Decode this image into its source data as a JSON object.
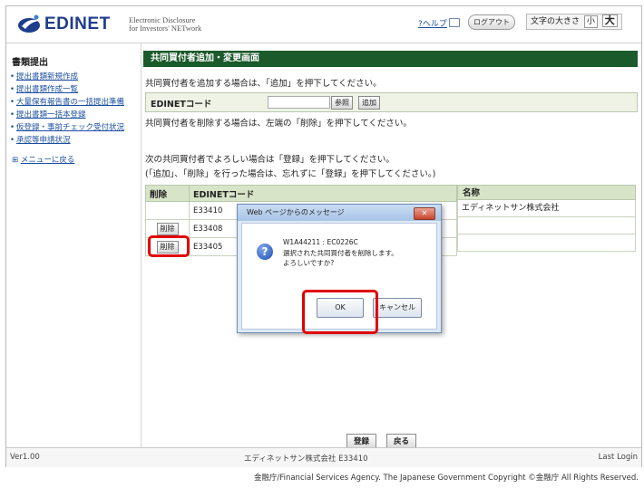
{
  "header": {
    "logo_text": "EDINET",
    "logo_subtitle_1": "Electronic Disclosure",
    "logo_subtitle_2": "for Investors' NETwork",
    "help_label": "?ヘルプ",
    "logout_label": "ログアウト",
    "font_size_label": "文字の大きさ",
    "font_small": "小",
    "font_large": "大"
  },
  "sidebar": {
    "title": "書類提出",
    "items": [
      {
        "label": "提出書類新規作成"
      },
      {
        "label": "提出書類作成一覧"
      },
      {
        "label": "大量保有報告書の一括提出準備"
      },
      {
        "label": "提出書類一括本登録"
      },
      {
        "label": "仮登録・事前チェック受付状況"
      },
      {
        "label": "承認等申請状況"
      }
    ],
    "back_label": "メニューに戻る"
  },
  "main": {
    "page_title": "共同買付者追加・変更画面",
    "add_instruction": "共同買付者を追加する場合は、「追加」を押下してください。",
    "code_label": "EDINETコード",
    "code_value": "",
    "ref_button": "参照",
    "add_button": "追加",
    "delete_instruction": "共同買付者を削除する場合は、左端の「削除」を押下してください。",
    "register_instruction_1": "次の共同買付者でよろしい場合は「登録」を押下してください。",
    "register_instruction_2": "(「追加」、「削除」を行った場合は、忘れずに「登録」を押下してください。)",
    "table": {
      "headers": {
        "delete": "削除",
        "code": "EDINETコード",
        "name": "名称"
      },
      "rows": [
        {
          "delete": "",
          "code": "E33410",
          "name": "エディネットサン株式会社"
        },
        {
          "delete": "削除",
          "code": "E33408",
          "name": ""
        },
        {
          "delete": "削除",
          "code": "E33405",
          "name": ""
        }
      ]
    },
    "register_button": "登録",
    "back_button": "戻る"
  },
  "dialog": {
    "title": "Web ページからのメッセージ",
    "close_label": "✕",
    "message_code": "W1A44211 : EC0226C",
    "message_line_1": "選択された共同買付者を削除します。",
    "message_line_2": "よろしいですか?",
    "ok_label": "OK",
    "cancel_label": "キャンセル"
  },
  "footer": {
    "version": "Ver1.00",
    "company": "エディネットサン株式会社 E33410",
    "last_login": "Last Login",
    "copyright": "金融庁/Financial Services Agency. The Japanese Government Copyright ©金融庁 All Rights Reserved."
  },
  "colors": {
    "page_title_bar": "#1b5a2a",
    "highlight": "#e10000",
    "link": "#1b4fa0",
    "logo": "#1e3c8c"
  }
}
